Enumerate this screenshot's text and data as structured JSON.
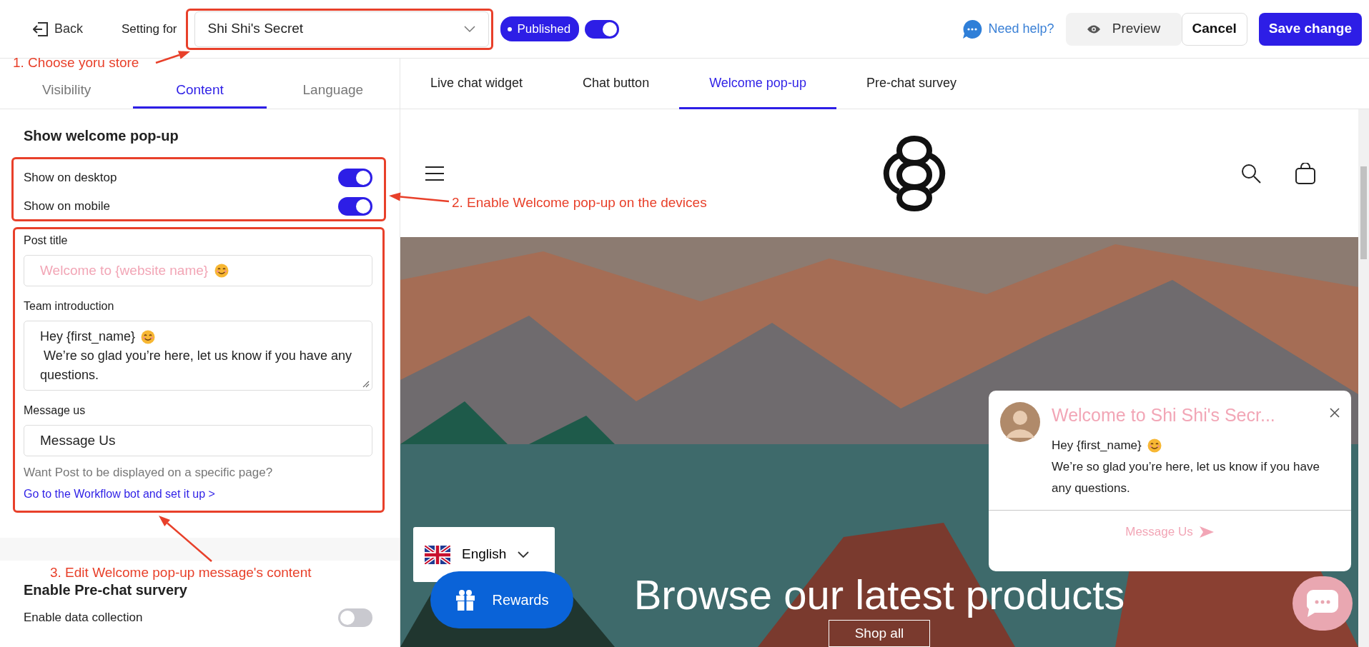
{
  "header": {
    "back": "Back",
    "setting_label": "Setting for",
    "store": "Shi Shi's Secret",
    "status": "Published",
    "status_on": true,
    "help": "Need help?",
    "preview": "Preview",
    "cancel": "Cancel",
    "save": "Save change"
  },
  "settings_tabs": [
    {
      "label": "Visibility",
      "selected": false
    },
    {
      "label": "Content",
      "selected": true
    },
    {
      "label": "Language",
      "selected": false
    }
  ],
  "preview_tabs": [
    {
      "label": "Live chat widget",
      "selected": false
    },
    {
      "label": "Chat button",
      "selected": false
    },
    {
      "label": "Welcome pop-up",
      "selected": true
    },
    {
      "label": "Pre-chat survey",
      "selected": false
    }
  ],
  "welcome_section": {
    "title": "Show welcome pop-up",
    "toggles": [
      {
        "label": "Show on desktop",
        "on": true
      },
      {
        "label": "Show on mobile",
        "on": true
      }
    ],
    "post_title": {
      "label": "Post title",
      "placeholder": "Welcome to {website name}"
    },
    "team_intro": {
      "label": "Team introduction",
      "line_1": "Hey {first_name}",
      "line_2": " We’re so glad you’re here, let us know if you have any questions."
    },
    "message_us": {
      "label": "Message us",
      "value": "Message Us"
    },
    "hint": "Want Post to be displayed on a specific page?",
    "hint_link": "Go to the Workflow bot and set it up >"
  },
  "survey_section": {
    "title": "Enable Pre-chat survery",
    "toggles": [
      {
        "label": "Enable data collection",
        "on": false
      }
    ]
  },
  "store_preview": {
    "hero_title": "Browse our latest products",
    "hero_button": "Shop all",
    "language": "English",
    "rewards": "Rewards",
    "popup": {
      "title": "Welcome to Shi Shi's Secr...",
      "greeting": "Hey {first_name}",
      "message": "We’re so glad you’re here, let us know if you have any questions.",
      "action": "Message Us"
    }
  },
  "annotations": [
    {
      "text": "1. Choose yoru store"
    },
    {
      "text": "2. Enable Welcome pop-up on the devices"
    },
    {
      "text": "3. Edit Welcome pop-up message's content"
    }
  ]
}
